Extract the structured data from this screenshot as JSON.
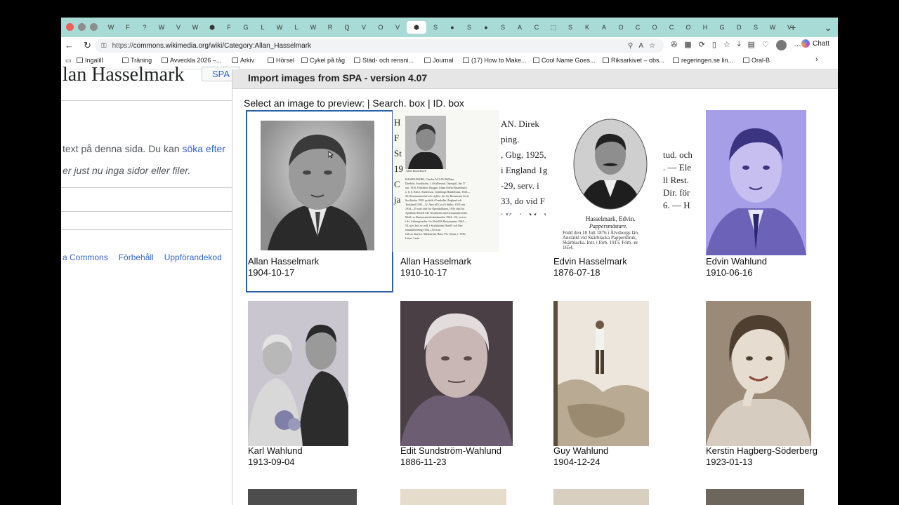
{
  "browser": {
    "tab_favicons": [
      "W",
      "F",
      "?",
      "W",
      "V",
      "W",
      "⬢",
      "F",
      "G",
      "L",
      "W",
      "L",
      "W",
      "R",
      "Q",
      "V",
      "O",
      "V",
      "⬢",
      "S",
      "●",
      "S",
      "●",
      "S",
      "A",
      "C",
      "⬚",
      "S",
      "K",
      "A",
      "O",
      "C",
      "O",
      "C",
      "O",
      "H",
      "G",
      "O",
      "S",
      "W",
      "V",
      "W",
      "V",
      "E",
      "W",
      "V",
      "W",
      "C",
      "O",
      "e",
      "S",
      "V",
      "O",
      "⬢",
      "H",
      "O",
      "O",
      "S",
      "W",
      "V",
      "G",
      "S"
    ],
    "url_scheme": "https://",
    "url_rest": "commons.wikimedia.org/wiki/Category:Allan_Hasselmark",
    "chat_label": "Chatt",
    "bookmarks": [
      {
        "label": "Ingalill"
      },
      {
        "label": "Träning"
      },
      {
        "label": "Avveckla 2026 –..."
      },
      {
        "label": "Arkiv"
      },
      {
        "label": "Hörsel"
      },
      {
        "label": "Cykel på tåg"
      },
      {
        "label": "Städ- och rensni..."
      },
      {
        "label": "Journal"
      },
      {
        "label": "(17) How to Make..."
      },
      {
        "label": "Cool Name Goes..."
      },
      {
        "label": "Riksarkivet – obs..."
      },
      {
        "label": "regeringen.se lin..."
      },
      {
        "label": "Oral-B"
      }
    ]
  },
  "wiki": {
    "title_fragment": "lan Hasselmark",
    "spa_tab": "SPA",
    "text_before_link": "text på denna sida. Du kan ",
    "link": "söka efter",
    "text2": "er just nu inga sidor eller filer.",
    "footer_links": [
      "a Commons",
      "Förbehåll",
      "Uppförandekod",
      "U"
    ]
  },
  "dialog": {
    "title": "Import images from SPA - version 4.07",
    "prompt": "Select an image to preview: | Search. box | ID. box",
    "images": [
      {
        "name": "Allan Hasselmark",
        "date": "1904-10-17"
      },
      {
        "name": "Allan Hasselmark",
        "date": "1910-10-17"
      },
      {
        "name": "Edvin Hasselmark",
        "date": "1876-07-18"
      },
      {
        "name": "Edvin Wahlund",
        "date": "1910-06-16"
      },
      {
        "name": "Karl Wahlund",
        "date": "1913-09-04"
      },
      {
        "name": "Edit Sundström-Wahlund",
        "date": "1886-11-23"
      },
      {
        "name": "Guy Wahlund",
        "date": "1904-12-24"
      },
      {
        "name": "Kerstin Hagberg-Söderberg",
        "date": "1923-01-13"
      }
    ],
    "scan1": {
      "caption": "Allan Hasselmark",
      "body": "HASSELMARK, Charles ALLAN William\nDirektör, Stockholm, f. i Kullerstad, Östergötl. län 17\nokt. 1910. Föräldrar: Byggm. Johan Edvin Hasselmark\no. h. h. Elin f. Andersson. Göteborgs Handelsinst. 1925—\n26, Restaurantschef och styklst. dir. för Restaurant Cecil,\nStockholm 1928, praktik i Frankrike, England och\nTyskland 1930—32. Anst till Cecil i Sthlm. 1933 och\n1934—35 som chef för Operakällaren, 1936 chef för\nApollonia Hotell AB, Stockholm med restaurantrörelse.\nMedl. av Restaurantsskolenämnden 1944—56, revisor\ni Sv. Arbetsgivarför. för Hotell & Restauranter 1944—\n54, styr. led. av ordf. i Stockholms Hotell- och Res-\ntaurantförening 1944—54 m.m.\nGift m. Karin f. Markström. Barn: Per Göran, f. 1936.\nLinné. Latin.",
      "top_lines": [
        "H",
        "F",
        "St",
        "19",
        "C",
        "ja"
      ]
    },
    "scan2": {
      "lines": [
        "AN. Direk",
        "ping.",
        ", Gbg, 1925,",
        "i England 1g",
        "-29, serv. i",
        "33, do vid F",
        "i Karin Marl"
      ]
    },
    "scan3": {
      "name": "Hasselmark, Edvin.",
      "occupation": "Pappersmästare.",
      "body": "Född den 18 Juli 1876 i Älvsborgs län.\nAnställd vid Skärblacka Pappersbruk,\nSkärblacka. Intr. i förb. 1915. Förb.-nr\n1654."
    },
    "scan4": {
      "lines": [
        "tud. och",
        ". — Ele",
        "ll Rest.",
        "Dir. för",
        "6. — H"
      ]
    }
  }
}
